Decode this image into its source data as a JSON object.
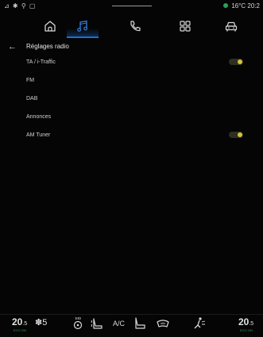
{
  "status": {
    "left_icons": "⊿ ✱ ⚲ ▢",
    "temperature": "16°C",
    "time": "20:2",
    "indicator_color": "#2aa05a"
  },
  "nav": {
    "items": [
      {
        "name": "home",
        "icon": "home-icon",
        "active": false
      },
      {
        "name": "music",
        "icon": "music-note-icon",
        "active": true
      },
      {
        "name": "phone",
        "icon": "phone-icon",
        "active": false
      },
      {
        "name": "apps",
        "icon": "apps-grid-icon",
        "active": false
      },
      {
        "name": "vehicle",
        "icon": "car-icon",
        "active": false
      }
    ],
    "accent_color": "#1e6fd0"
  },
  "header": {
    "back_glyph": "←",
    "title": "Réglages radio"
  },
  "settings": [
    {
      "label": "TA / i-Traffic",
      "toggle": true,
      "on": true
    },
    {
      "label": "FM",
      "toggle": false
    },
    {
      "label": "DAB",
      "toggle": false
    },
    {
      "label": "Annonces",
      "toggle": false
    },
    {
      "label": "AM Tuner",
      "toggle": true,
      "on": true
    }
  ],
  "climate": {
    "left_temp": "20",
    "left_temp_decimal": ".5",
    "left_eco": "ECO ON",
    "fan_glyph": "✽",
    "fan_level": "5",
    "ac_label": "A/C",
    "right_temp": "20",
    "right_temp_decimal": ".5",
    "right_eco": "ECO ON",
    "eco_color": "#27a35a"
  }
}
